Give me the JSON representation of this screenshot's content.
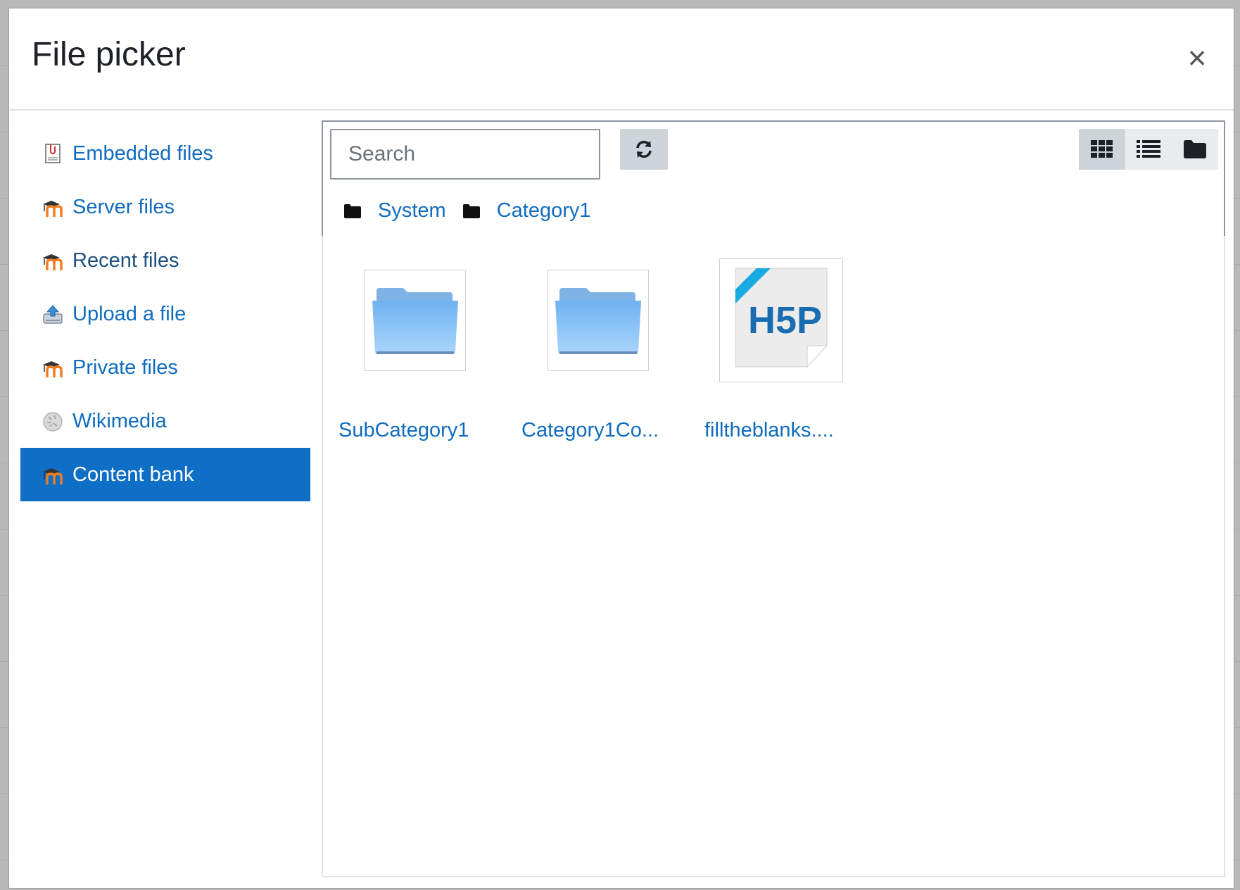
{
  "dialog": {
    "title": "File picker",
    "close_label": "×"
  },
  "sidebar": {
    "items": [
      {
        "label": "Embedded files",
        "icon": "embedded-files-icon",
        "active": false
      },
      {
        "label": "Server files",
        "icon": "moodle-icon",
        "active": false
      },
      {
        "label": "Recent files",
        "icon": "moodle-icon",
        "active": false
      },
      {
        "label": "Upload a file",
        "icon": "upload-icon",
        "active": false
      },
      {
        "label": "Private files",
        "icon": "moodle-icon",
        "active": false
      },
      {
        "label": "Wikimedia",
        "icon": "wikimedia-icon",
        "active": false
      },
      {
        "label": "Content bank",
        "icon": "moodle-icon",
        "active": true
      }
    ]
  },
  "toolbar": {
    "search_placeholder": "Search",
    "refresh_icon": "refresh-icon",
    "views": [
      {
        "name": "icons-view",
        "icon": "grid-icon",
        "active": true
      },
      {
        "name": "list-view",
        "icon": "list-icon",
        "active": false
      },
      {
        "name": "tree-view",
        "icon": "folder-icon",
        "active": false
      }
    ]
  },
  "breadcrumb": [
    {
      "label": "System",
      "icon": "folder-icon"
    },
    {
      "label": "Category1",
      "icon": "folder-icon"
    }
  ],
  "files": [
    {
      "label": "SubCategory1",
      "type": "folder"
    },
    {
      "label": "Category1Co...",
      "type": "folder"
    },
    {
      "label": "filltheblanks....",
      "type": "h5p"
    }
  ],
  "colors": {
    "link": "#0f6cbf",
    "active_bg": "#0f6fc6",
    "button_bg": "#ced4da"
  }
}
